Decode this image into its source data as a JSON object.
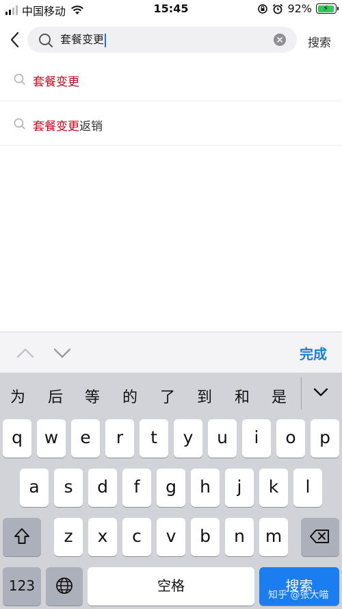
{
  "status_bar": {
    "carrier": "中国移动",
    "time": "15:45",
    "battery_percent": "92%",
    "battery_level": 0.92,
    "icons": [
      "signal-icon",
      "wifi-icon",
      "rotation-lock-icon",
      "alarm-icon",
      "battery-icon"
    ]
  },
  "search": {
    "query": "套餐变更",
    "submit_label": "搜索",
    "icons": [
      "back-icon",
      "search-icon",
      "clear-icon"
    ]
  },
  "suggestions": [
    {
      "highlight": "套餐变更",
      "rest": ""
    },
    {
      "highlight": "套餐变更",
      "rest": "返销"
    }
  ],
  "keyboard_toolbar": {
    "done_label": "完成",
    "icons": [
      "chevron-up-icon",
      "chevron-down-icon"
    ]
  },
  "keyboard": {
    "candidates": [
      "为",
      "后",
      "等",
      "的",
      "了",
      "到",
      "和",
      "是"
    ],
    "row1": [
      "q",
      "w",
      "e",
      "r",
      "t",
      "y",
      "u",
      "i",
      "o",
      "p"
    ],
    "row2": [
      "a",
      "s",
      "d",
      "f",
      "g",
      "h",
      "j",
      "k",
      "l"
    ],
    "row3": [
      "z",
      "x",
      "c",
      "v",
      "b",
      "n",
      "m"
    ],
    "numbers_label": "123",
    "space_label": "空格",
    "search_label": "搜索",
    "accent_color": "#1a7ef1"
  },
  "watermark": "知乎 @张大喵"
}
